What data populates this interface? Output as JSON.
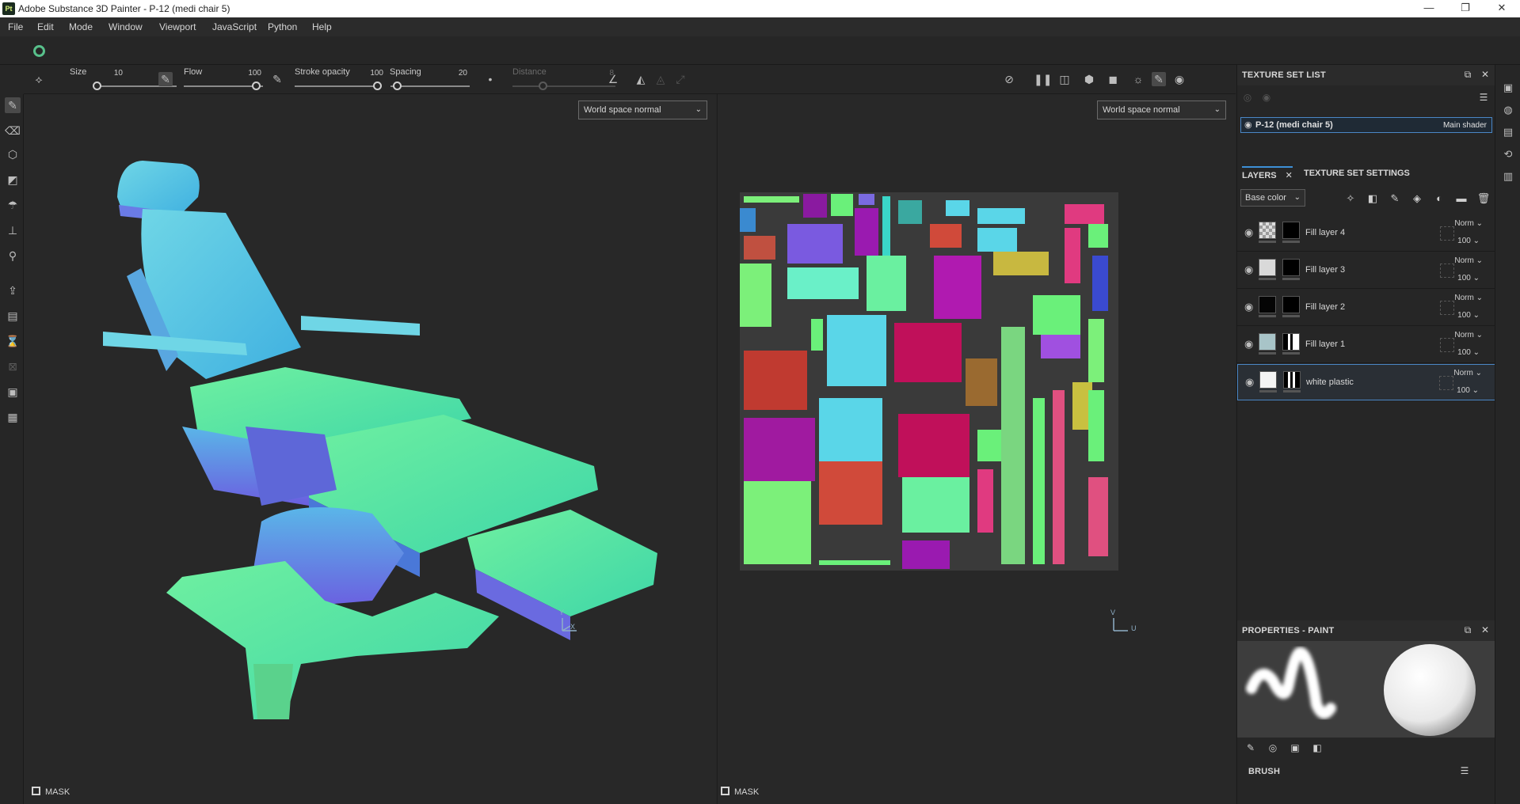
{
  "window": {
    "app_icon": "Pt",
    "title": "Adobe Substance 3D Painter - P-12 (medi chair 5)",
    "minimize": "—",
    "maximize": "❐",
    "close": "✕"
  },
  "menu": [
    "File",
    "Edit",
    "Mode",
    "Window",
    "Viewport",
    "JavaScript",
    "Python",
    "Help"
  ],
  "toolbar": {
    "size_label": "Size",
    "size_value": "10",
    "flow_label": "Flow",
    "flow_value": "100",
    "stroke_opacity_label": "Stroke opacity",
    "stroke_opacity_value": "100",
    "spacing_label": "Spacing",
    "spacing_value": "20",
    "distance_label": "Distance",
    "distance_value": "8"
  },
  "viewports": {
    "left_mode": "World space normal",
    "right_mode": "World space normal",
    "left_mask": "MASK",
    "right_mask": "MASK",
    "axis_y": "Y",
    "axis_x": "X",
    "axis_v": "V",
    "axis_u": "U"
  },
  "texture_set_list": {
    "title": "TEXTURE SET LIST",
    "item_name": "P-12 (medi chair 5)",
    "item_shader": "Main shader"
  },
  "layers_panel": {
    "tab_layers": "LAYERS",
    "tab_settings": "TEXTURE SET SETTINGS",
    "channel": "Base color",
    "layers": [
      {
        "name": "Fill layer 4",
        "blend": "Norm",
        "opacity": "100"
      },
      {
        "name": "Fill layer 3",
        "blend": "Norm",
        "opacity": "100"
      },
      {
        "name": "Fill layer 2",
        "blend": "Norm",
        "opacity": "100"
      },
      {
        "name": "Fill layer 1",
        "blend": "Norm",
        "opacity": "100"
      },
      {
        "name": "white plastic",
        "blend": "Norm",
        "opacity": "100"
      }
    ]
  },
  "properties": {
    "title": "PROPERTIES - PAINT",
    "brush_label": "BRUSH"
  }
}
